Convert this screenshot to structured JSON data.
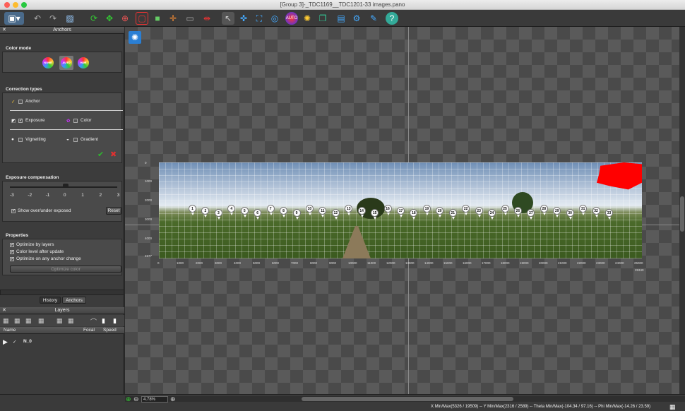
{
  "window": {
    "title": "[Group 3]-_TDC1169__TDC1201-33 images.pano"
  },
  "anchors_panel": {
    "title": "Anchors",
    "color_mode": {
      "title": "Color mode",
      "buttons": [
        "NONE",
        "AUTO",
        "HDR"
      ]
    },
    "correction_types": {
      "title": "Correction types",
      "anchor": "Anchor",
      "exposure": "Exposure",
      "color": "Color",
      "vignetting": "Vignetting",
      "gradient": "Gradient"
    },
    "exposure_compensation": {
      "title": "Exposure compensation",
      "ticks": [
        "-3",
        "-2",
        "-1",
        "0",
        "1",
        "2",
        "3"
      ],
      "show_over_under": "Show over/under exposed",
      "reset": "Reset"
    },
    "properties": {
      "title": "Properties",
      "optimize_by_layers": "Optimize by layers",
      "color_level": "Color level after update",
      "optimize_any": "Optimize on any anchor change",
      "optimize_button": "Optimize color"
    },
    "tabs": [
      "History",
      "Anchors"
    ]
  },
  "layers_panel": {
    "title": "Layers",
    "columns": [
      "Name",
      "Focal",
      "Speed"
    ],
    "rows": [
      {
        "name": "N_0"
      }
    ]
  },
  "canvas": {
    "x_ticks": [
      "0",
      "1000",
      "2000",
      "3000",
      "4000",
      "5000",
      "6000",
      "7000",
      "8000",
      "9000",
      "10000",
      "11000",
      "12000",
      "13000",
      "14000",
      "15000",
      "16000",
      "17000",
      "18000",
      "19000",
      "20000",
      "21000",
      "22000",
      "23000",
      "24000",
      "25000"
    ],
    "x_end": "25340",
    "y_ticks": [
      "0",
      "1000",
      "2000",
      "3000",
      "4000",
      "4577"
    ],
    "pins": [
      "1",
      "2",
      "3",
      "4",
      "5",
      "6",
      "7",
      "8",
      "9",
      "10",
      "11",
      "12",
      "13",
      "14",
      "15",
      "16",
      "17",
      "18",
      "19",
      "20",
      "21",
      "22",
      "23",
      "24",
      "25",
      "26",
      "27",
      "28",
      "29",
      "30",
      "31",
      "32",
      "33"
    ]
  },
  "bottom": {
    "zoom": "4.78%",
    "status": "X Min/Max(5326 / 19509)  --  Y Min/Max(2316 / 2589)  --  Theta Min/Max(-104.34 / 97.16)  --  Phi Min/Max(-14.26 / 23.59)"
  },
  "colors": {
    "accent_blue": "#2a7fd4",
    "check_green": "#2fb52f",
    "cross_red": "#e23030",
    "overexposed_red": "#ff0000"
  }
}
